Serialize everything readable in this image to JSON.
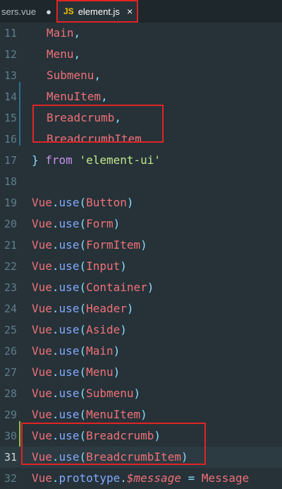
{
  "tabs": [
    {
      "label": "sers.vue",
      "indicator": "●",
      "active": false
    },
    {
      "label": "element.js",
      "badge": "JS",
      "close": "×",
      "active": true
    }
  ],
  "lines": [
    {
      "num": "11",
      "parts": [
        [
          "indent",
          ""
        ],
        [
          "ident",
          "Main"
        ],
        [
          "comma",
          ","
        ]
      ]
    },
    {
      "num": "12",
      "parts": [
        [
          "indent",
          ""
        ],
        [
          "ident",
          "Menu"
        ],
        [
          "comma",
          ","
        ]
      ]
    },
    {
      "num": "13",
      "parts": [
        [
          "indent",
          ""
        ],
        [
          "ident",
          "Submenu"
        ],
        [
          "comma",
          ","
        ]
      ]
    },
    {
      "num": "14",
      "parts": [
        [
          "indent",
          ""
        ],
        [
          "ident",
          "MenuItem"
        ],
        [
          "comma",
          ","
        ]
      ]
    },
    {
      "num": "15",
      "parts": [
        [
          "indent",
          ""
        ],
        [
          "ident",
          "Breadcrumb"
        ],
        [
          "comma",
          ","
        ]
      ]
    },
    {
      "num": "16",
      "parts": [
        [
          "indent",
          ""
        ],
        [
          "ident",
          "BreadcrumbItem"
        ]
      ]
    },
    {
      "num": "17",
      "parts": [
        [
          "brace",
          "}"
        ],
        [
          "plain",
          " "
        ],
        [
          "from",
          "from"
        ],
        [
          "plain",
          " "
        ],
        [
          "str",
          "'element-ui'"
        ]
      ]
    },
    {
      "num": "18",
      "parts": []
    },
    {
      "num": "19",
      "parts": [
        [
          "obj",
          "Vue"
        ],
        [
          "dot",
          "."
        ],
        [
          "method",
          "use"
        ],
        [
          "paren",
          "("
        ],
        [
          "cls",
          "Button"
        ],
        [
          "paren",
          ")"
        ]
      ]
    },
    {
      "num": "20",
      "parts": [
        [
          "obj",
          "Vue"
        ],
        [
          "dot",
          "."
        ],
        [
          "method",
          "use"
        ],
        [
          "paren",
          "("
        ],
        [
          "cls",
          "Form"
        ],
        [
          "paren",
          ")"
        ]
      ]
    },
    {
      "num": "21",
      "parts": [
        [
          "obj",
          "Vue"
        ],
        [
          "dot",
          "."
        ],
        [
          "method",
          "use"
        ],
        [
          "paren",
          "("
        ],
        [
          "cls",
          "FormItem"
        ],
        [
          "paren",
          ")"
        ]
      ]
    },
    {
      "num": "22",
      "parts": [
        [
          "obj",
          "Vue"
        ],
        [
          "dot",
          "."
        ],
        [
          "method",
          "use"
        ],
        [
          "paren",
          "("
        ],
        [
          "cls",
          "Input"
        ],
        [
          "paren",
          ")"
        ]
      ]
    },
    {
      "num": "23",
      "parts": [
        [
          "obj",
          "Vue"
        ],
        [
          "dot",
          "."
        ],
        [
          "method",
          "use"
        ],
        [
          "paren",
          "("
        ],
        [
          "cls",
          "Container"
        ],
        [
          "paren",
          ")"
        ]
      ]
    },
    {
      "num": "24",
      "parts": [
        [
          "obj",
          "Vue"
        ],
        [
          "dot",
          "."
        ],
        [
          "method",
          "use"
        ],
        [
          "paren",
          "("
        ],
        [
          "cls",
          "Header"
        ],
        [
          "paren",
          ")"
        ]
      ]
    },
    {
      "num": "25",
      "parts": [
        [
          "obj",
          "Vue"
        ],
        [
          "dot",
          "."
        ],
        [
          "method",
          "use"
        ],
        [
          "paren",
          "("
        ],
        [
          "cls",
          "Aside"
        ],
        [
          "paren",
          ")"
        ]
      ]
    },
    {
      "num": "26",
      "parts": [
        [
          "obj",
          "Vue"
        ],
        [
          "dot",
          "."
        ],
        [
          "method",
          "use"
        ],
        [
          "paren",
          "("
        ],
        [
          "cls",
          "Main"
        ],
        [
          "paren",
          ")"
        ]
      ]
    },
    {
      "num": "27",
      "parts": [
        [
          "obj",
          "Vue"
        ],
        [
          "dot",
          "."
        ],
        [
          "method",
          "use"
        ],
        [
          "paren",
          "("
        ],
        [
          "cls",
          "Menu"
        ],
        [
          "paren",
          ")"
        ]
      ]
    },
    {
      "num": "28",
      "parts": [
        [
          "obj",
          "Vue"
        ],
        [
          "dot",
          "."
        ],
        [
          "method",
          "use"
        ],
        [
          "paren",
          "("
        ],
        [
          "cls",
          "Submenu"
        ],
        [
          "paren",
          ")"
        ]
      ]
    },
    {
      "num": "29",
      "parts": [
        [
          "obj",
          "Vue"
        ],
        [
          "dot",
          "."
        ],
        [
          "method",
          "use"
        ],
        [
          "paren",
          "("
        ],
        [
          "cls",
          "MenuItem"
        ],
        [
          "paren",
          ")"
        ]
      ]
    },
    {
      "num": "30",
      "parts": [
        [
          "obj",
          "Vue"
        ],
        [
          "dot",
          "."
        ],
        [
          "method",
          "use"
        ],
        [
          "paren",
          "("
        ],
        [
          "cls",
          "Breadcrumb"
        ],
        [
          "paren",
          ")"
        ]
      ]
    },
    {
      "num": "31",
      "parts": [
        [
          "obj",
          "Vue"
        ],
        [
          "dot",
          "."
        ],
        [
          "method",
          "use"
        ],
        [
          "paren",
          "("
        ],
        [
          "cls",
          "BreadcrumbItem"
        ],
        [
          "paren",
          ")"
        ]
      ]
    },
    {
      "num": "32",
      "parts": [
        [
          "obj",
          "Vue"
        ],
        [
          "dot",
          "."
        ],
        [
          "method",
          "prototype"
        ],
        [
          "dot",
          "."
        ],
        [
          "var",
          "$message"
        ],
        [
          "plain",
          " "
        ],
        [
          "op",
          "="
        ],
        [
          "plain",
          " "
        ],
        [
          "cls",
          "Message"
        ]
      ]
    }
  ],
  "current_line": "31",
  "colors": {
    "background": "#263238",
    "highlight_box": "#e02424",
    "line_number": "#5f7e8a"
  }
}
